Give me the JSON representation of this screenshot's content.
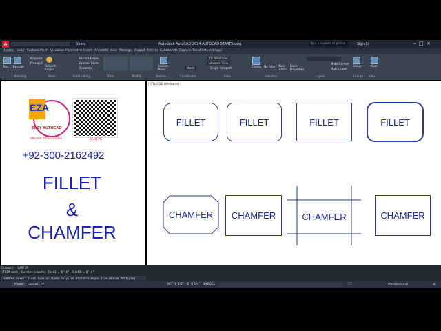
{
  "app": {
    "title": "Autodesk AutoCAD 2024   AUTOCAD STARTS.dwg",
    "search_placeholder": "Type a keyword or phrase",
    "signin": "Sign In",
    "share": "Share"
  },
  "tabs": [
    "Home",
    "Solid",
    "Surface",
    "Mesh",
    "Visualize",
    "Parametric",
    "Insert",
    "Annotate",
    "View",
    "Manage",
    "Output",
    "Add-ins",
    "Collaborate",
    "Express Tools",
    "Featured Apps"
  ],
  "ribbon": {
    "box": "Box",
    "extrude": "Extrude",
    "polysolid": "Polysolid",
    "presspull": "Presspull",
    "smooth_object": "Smooth Object",
    "extract_edges": "Extract Edges",
    "extrude_faces": "Extrude Faces",
    "separate": "Separate",
    "section_plane": "Section Plane",
    "visual_style": "2D Wireframe",
    "view_name": "Unsaved View",
    "coordinate": "World",
    "single_viewport": "Single viewport",
    "culling": "Culling",
    "no_filter": "No Filter",
    "move_gizmo": "Move Gizmo",
    "layer_properties": "Layer Properties",
    "make_current": "Make Current",
    "match_layer": "Match Layer",
    "group": "Group",
    "base": "Base",
    "panels": [
      "Modeling",
      "Mesh",
      "Solid Editing",
      "Draw",
      "Modify",
      "Section",
      "Coordinates",
      "View",
      "Selection",
      "Layers",
      "Groups",
      "View"
    ]
  },
  "viewport": {
    "label": "[-][Top][2D Wireframe]",
    "fillet_label": "FILLET",
    "chamfer_label": "CHAMFER"
  },
  "left": {
    "logo_text": "EASY AUTOCAD",
    "logo_letters": "EZA",
    "logo_sub": "UNLOCK YOUR FUTURE",
    "scan_me": "SCAN ME",
    "phone": "+92-300-2162492",
    "line1": "FILLET",
    "line2": "&",
    "line3": "CHAMFER"
  },
  "command": {
    "line1": "Command: CHAMFER",
    "line2": "(TRIM mode) Current chamfer Dist1 = 0'-6\", Dist2 = 0'-6\"",
    "prompt": "CHAMFER Select first line or [Undo Polyline Distance Angle Trim mEthod Multiple]:"
  },
  "status": {
    "model": "Model",
    "layout": "Layout1",
    "coords": "367'-6 1/2\", -2'-6 1/4\", 0'-0\"",
    "mode": "MODEL",
    "scale": "11",
    "workspace": "Architectural"
  }
}
